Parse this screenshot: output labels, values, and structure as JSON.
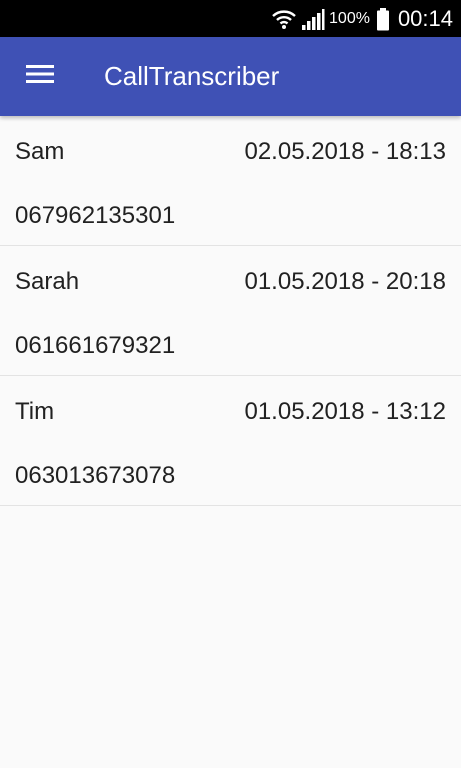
{
  "status_bar": {
    "wifi_icon": "wifi-icon",
    "signal_icon": "signal-icon",
    "battery_percent": "100%",
    "battery_icon": "battery-icon",
    "time": "00:14"
  },
  "app_bar": {
    "menu_icon": "menu-icon",
    "title": "CallTranscriber",
    "color": "#3f51b5"
  },
  "calls": [
    {
      "name": "Sam",
      "datetime": "02.05.2018 - 18:13",
      "number": "067962135301"
    },
    {
      "name": "Sarah",
      "datetime": "01.05.2018 - 20:18",
      "number": "061661679321"
    },
    {
      "name": "Tim",
      "datetime": "01.05.2018 - 13:12",
      "number": "063013673078"
    }
  ]
}
